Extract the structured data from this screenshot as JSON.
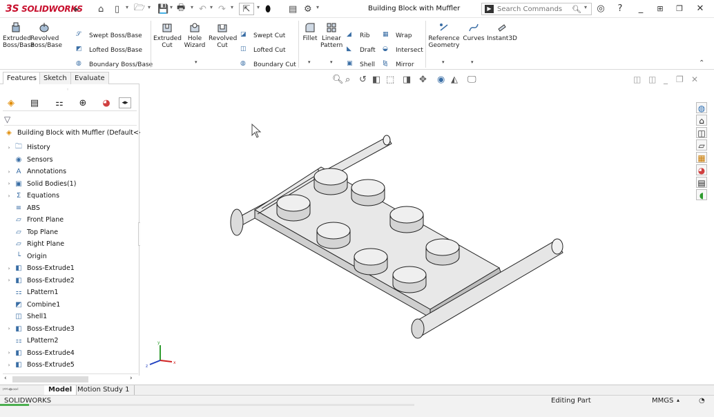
{
  "app": {
    "brand_prefix": "3S",
    "brand_name": "SOLIDWORKS",
    "doc_title": "Building Block with Muffler"
  },
  "search": {
    "placeholder": "Search Commands"
  },
  "ribbon": {
    "extruded_boss": "Extruded Boss/Base",
    "revolved_boss": "Revolved Boss/Base",
    "swept_boss": "Swept Boss/Base",
    "lofted_boss": "Lofted Boss/Base",
    "boundary_boss": "Boundary Boss/Base",
    "extruded_cut": "Extruded Cut",
    "hole_wizard": "Hole Wizard",
    "revolved_cut": "Revolved Cut",
    "swept_cut": "Swept Cut",
    "lofted_cut": "Lofted Cut",
    "boundary_cut": "Boundary Cut",
    "fillet": "Fillet",
    "linear_pattern": "Linear Pattern",
    "rib": "Rib",
    "draft": "Draft",
    "shell": "Shell",
    "wrap": "Wrap",
    "intersect": "Intersect",
    "mirror": "Mirror",
    "reference_geometry": "Reference Geometry",
    "curves": "Curves",
    "instant3d": "Instant3D"
  },
  "tabs": {
    "features": "Features",
    "sketch": "Sketch",
    "evaluate": "Evaluate"
  },
  "tree": {
    "root": "Building Block with Muffler  (Default<<D",
    "items": [
      "History",
      "Sensors",
      "Annotations",
      "Solid Bodies(1)",
      "Equations",
      "ABS",
      "Front Plane",
      "Top Plane",
      "Right Plane",
      "Origin",
      "Boss-Extrude1",
      "Boss-Extrude2",
      "LPattern1",
      "Combine1",
      "Shell1",
      "Boss-Extrude3",
      "LPattern2",
      "Boss-Extrude4",
      "Boss-Extrude5"
    ]
  },
  "bottom_tabs": {
    "model": "Model",
    "motion": "Motion Study 1"
  },
  "status": {
    "left": "SOLIDWORKS",
    "mode": "Editing Part",
    "units": "MMGS",
    "progress": 0.07
  },
  "axes": {
    "x": "x",
    "y": "y",
    "z": "z"
  },
  "colors": {
    "brand": "#c8102e",
    "model_face": "#e2e2e2",
    "accent": "#2b6cb0"
  }
}
